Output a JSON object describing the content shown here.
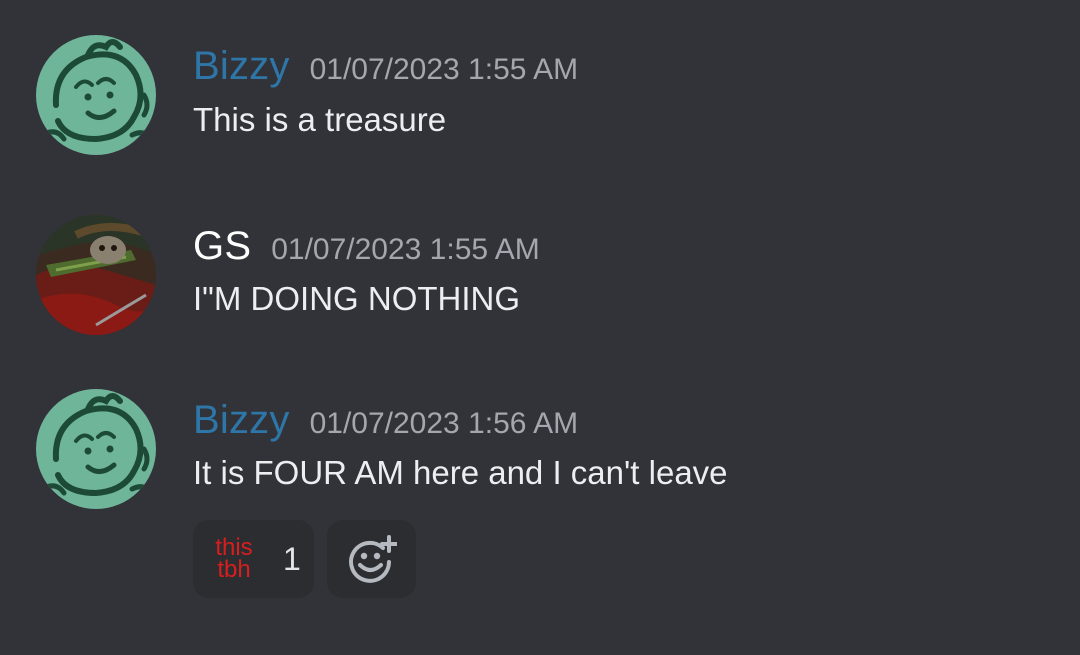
{
  "messages": [
    {
      "username": "Bizzy",
      "username_color": "#2e76a8",
      "timestamp": "01/07/2023 1:55 AM",
      "text": "This is a treasure",
      "avatar": "green-doodle-girl-avatar"
    },
    {
      "username": "GS",
      "username_color": "#ffffff",
      "timestamp": "01/07/2023 1:55 AM",
      "text": "I\"M DOING NOTHING",
      "avatar": "dark-armored-character-avatar"
    },
    {
      "username": "Bizzy",
      "username_color": "#2e76a8",
      "timestamp": "01/07/2023 1:56 AM",
      "text": "It is FOUR AM here and I can't leave",
      "avatar": "green-doodle-girl-avatar",
      "reactions": [
        {
          "emoji_line1": "this",
          "emoji_line2": "tbh",
          "emoji_color": "#d81e1e",
          "count": "1"
        }
      ],
      "add_reaction_icon": "add-reaction-smiley-icon"
    }
  ],
  "colors": {
    "background": "#313338",
    "reaction_background": "#2b2d31",
    "timestamp": "#a4a7ad"
  }
}
